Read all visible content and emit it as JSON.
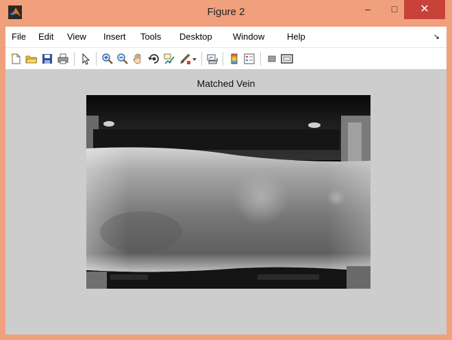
{
  "window": {
    "title": "Figure 2",
    "frame_color": "#F0A07C",
    "close_color": "#C7433A"
  },
  "window_controls": {
    "minimize": "–",
    "maximize": "□",
    "close": "✕"
  },
  "menu": {
    "items": [
      "File",
      "Edit",
      "View",
      "Insert",
      "Tools",
      "Desktop",
      "Window",
      "Help"
    ],
    "overflow_arrow": "↘"
  },
  "toolbar": {
    "icons": [
      "new-figure-icon",
      "open-file-icon",
      "save-icon",
      "print-icon",
      "select-arrow-icon",
      "zoom-in-icon",
      "zoom-out-icon",
      "pan-hand-icon",
      "rotate-3d-icon",
      "data-cursor-icon",
      "brush-icon",
      "brush-dropdown-icon",
      "link-plot-icon",
      "colorbar-icon",
      "legend-icon",
      "hide-plot-tools-icon",
      "show-plot-tools-icon"
    ]
  },
  "figure": {
    "background": "#CDCDCD"
  },
  "axes": {
    "title": "Matched Vein"
  }
}
